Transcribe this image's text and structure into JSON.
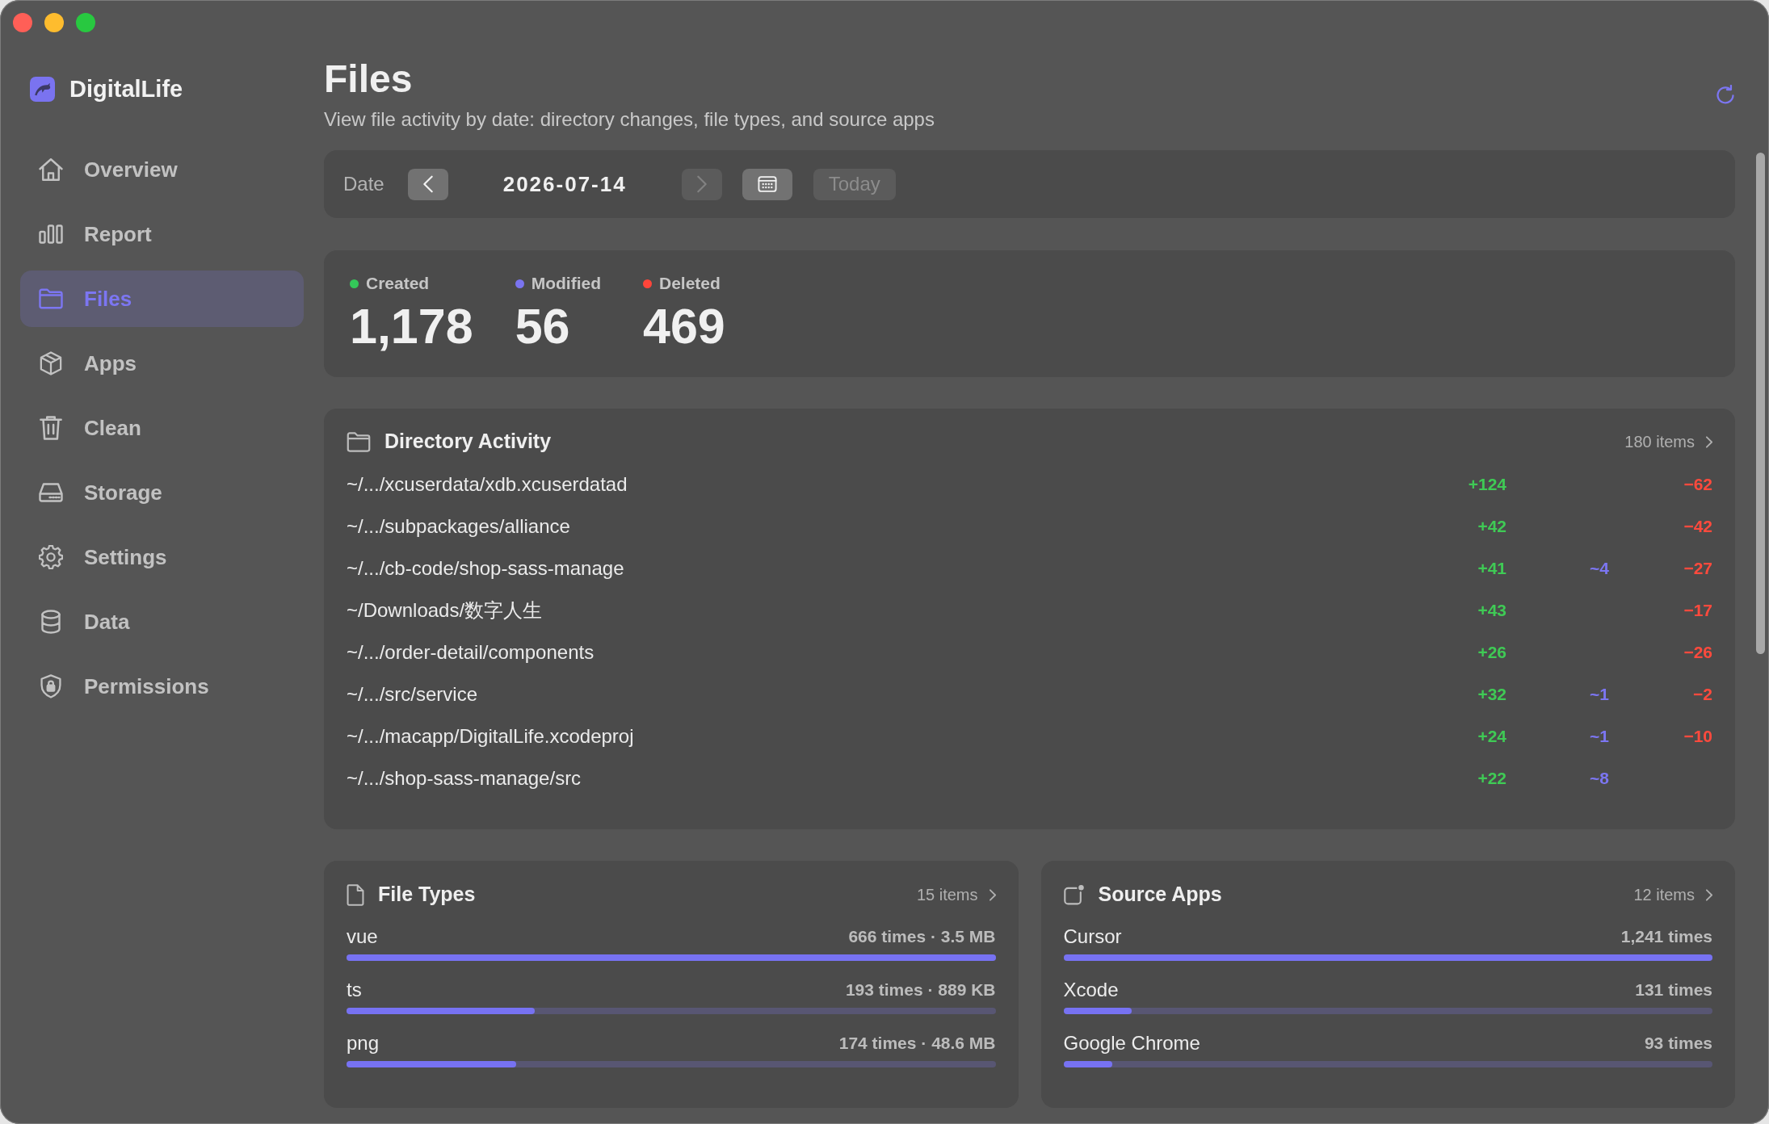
{
  "sidebar": {
    "app_name": "DigitalLife",
    "items": [
      {
        "label": "Overview",
        "selected": false
      },
      {
        "label": "Report",
        "selected": false
      },
      {
        "label": "Files",
        "selected": true
      },
      {
        "label": "Apps",
        "selected": false
      },
      {
        "label": "Clean",
        "selected": false
      },
      {
        "label": "Storage",
        "selected": false
      },
      {
        "label": "Settings",
        "selected": false
      },
      {
        "label": "Data",
        "selected": false
      },
      {
        "label": "Permissions",
        "selected": false
      }
    ]
  },
  "header": {
    "title": "Files",
    "subtitle": "View file activity by date: directory changes, file types, and source apps"
  },
  "date_bar": {
    "label": "Date",
    "previous": {
      "disabled": false
    },
    "date": "2026-07-14",
    "next": {
      "disabled": true
    },
    "calendar": {
      "disabled": false
    },
    "today": {
      "label": "Today",
      "disabled": true
    }
  },
  "stats": [
    {
      "label": "Created",
      "value": "1,178",
      "color": "#34c759"
    },
    {
      "label": "Modified",
      "value": "56",
      "color": "#7a74f0"
    },
    {
      "label": "Deleted",
      "value": "469",
      "color": "#ff453a"
    }
  ],
  "directory_activity": {
    "title": "Directory Activity",
    "count": "180 items",
    "rows": [
      {
        "path": "~/.../xcuserdata/xdb.xcuserdatad",
        "created": "+124",
        "deleted": "−62"
      },
      {
        "path": "~/.../subpackages/alliance",
        "created": "+42",
        "deleted": "−42"
      },
      {
        "path": "~/.../cb-code/shop-sass-manage",
        "created": "+41",
        "modified": "~4",
        "deleted": "−27"
      },
      {
        "path": "~/Downloads/数字人生",
        "created": "+43",
        "deleted": "−17"
      },
      {
        "path": "~/.../order-detail/components",
        "created": "+26",
        "deleted": "−26"
      },
      {
        "path": "~/.../src/service",
        "created": "+32",
        "modified": "~1",
        "deleted": "−2"
      },
      {
        "path": "~/.../macapp/DigitalLife.xcodeproj",
        "created": "+24",
        "modified": "~1",
        "deleted": "−10"
      },
      {
        "path": "~/.../shop-sass-manage/src",
        "created": "+22",
        "modified": "~8"
      }
    ]
  },
  "file_types": {
    "title": "File Types",
    "count": "15 items",
    "rows": [
      {
        "name": "vue",
        "value": "666 times · 3.5 MB",
        "level": 1
      },
      {
        "name": "ts",
        "value": "193 times · 889 KB",
        "level": 0.29
      },
      {
        "name": "png",
        "value": "174 times · 48.6 MB",
        "level": 0.261
      }
    ]
  },
  "source_apps": {
    "title": "Source Apps",
    "count": "12 items",
    "rows": [
      {
        "name": "Cursor",
        "value": "1,241 times",
        "level": 1
      },
      {
        "name": "Xcode",
        "value": "131 times",
        "level": 0.105
      },
      {
        "name": "Google Chrome",
        "value": "93 times",
        "level": 0.075
      }
    ]
  }
}
